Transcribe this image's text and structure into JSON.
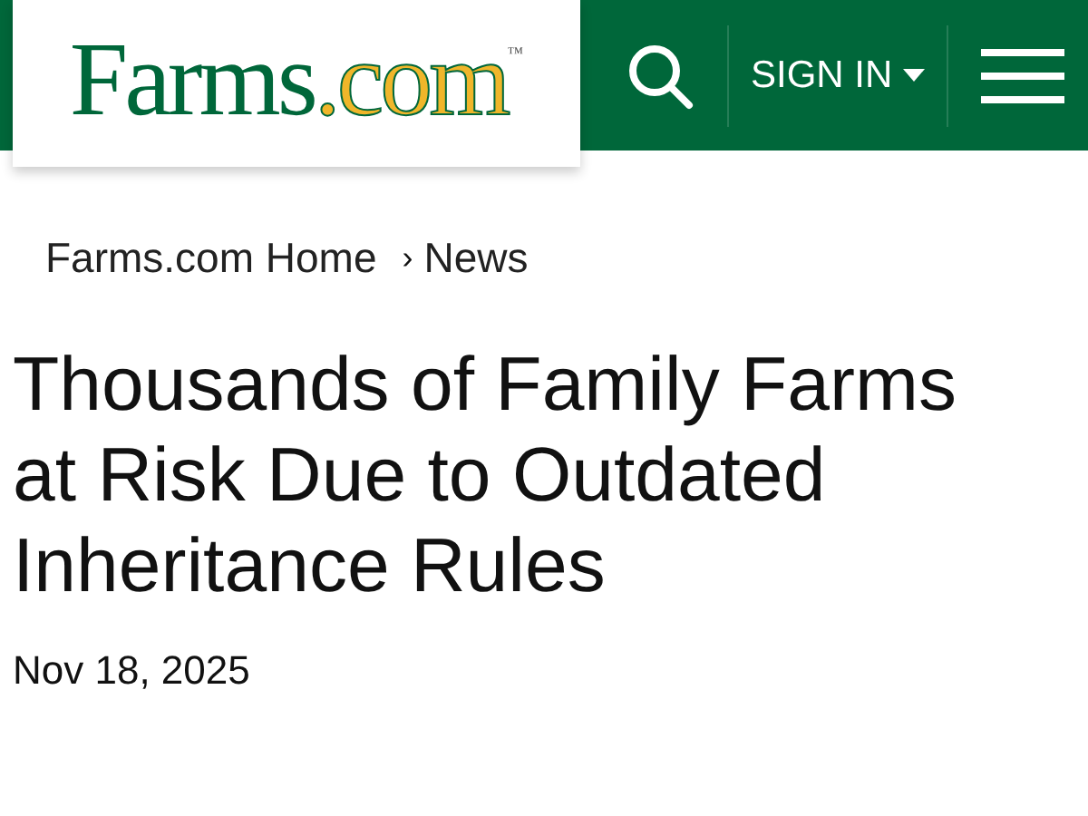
{
  "header": {
    "logo": {
      "name": "Farms",
      "suffix": ".com",
      "mark": "™"
    },
    "sign_in": "SIGN IN"
  },
  "breadcrumb": [
    {
      "label": "Farms.com Home"
    },
    {
      "label": "News",
      "separator": "›"
    }
  ],
  "article": {
    "title": "Thousands of Family Farms at Risk Due to Outdated Inheritance Rules",
    "date": "Nov 18, 2025"
  }
}
